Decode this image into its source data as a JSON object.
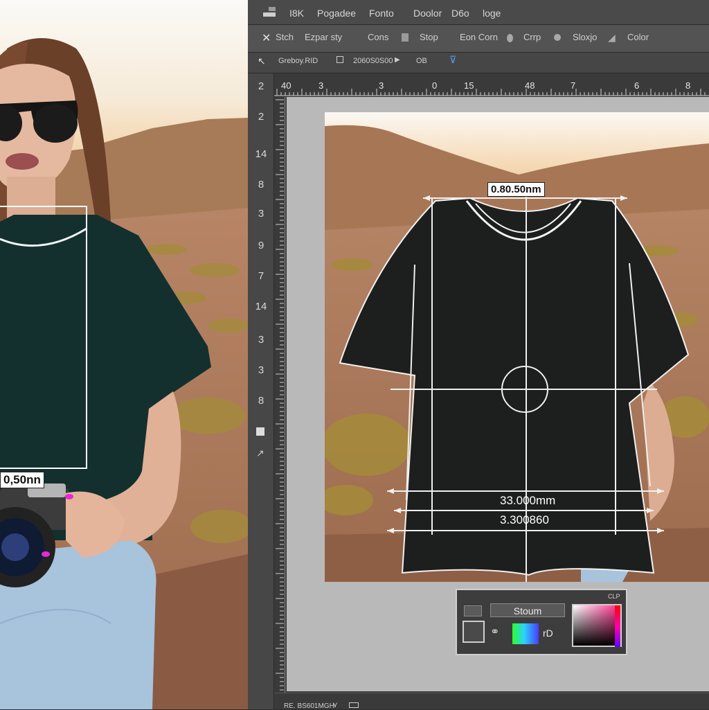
{
  "menu_bar": {
    "items": [
      "I8K",
      "Pogadee",
      "Fonto",
      "Doolor",
      "D6o",
      "loge"
    ]
  },
  "options_bar": {
    "items": [
      "Stch",
      "Ezpar sty",
      "Cons",
      "Stop",
      "Eon Corn",
      "Crrp",
      "Sloxjo",
      "Color"
    ]
  },
  "doc_tab_bar": {
    "doc_name": "Greboy.RID",
    "zoom_value": "2060S0S00",
    "mode": "OB"
  },
  "ruler": {
    "labels": [
      "40",
      "3",
      "3",
      "0",
      "15",
      "48",
      "7",
      "6",
      "8"
    ]
  },
  "toolbar": {
    "items": [
      "2",
      "2",
      "14",
      "8",
      "3",
      "9",
      "7",
      "14",
      "3",
      "3",
      "8"
    ]
  },
  "photo": {
    "measure_label": "0,50nn"
  },
  "canvas": {
    "top_measure": "0.80.50nm",
    "bottom_measure_1": "33.000mm",
    "bottom_measure_2": "3.300860"
  },
  "color_panel": {
    "header": "CLP",
    "field_value": "Stoum",
    "mode_label": "rD"
  },
  "status_bar": {
    "text": "RE. BS601MGH"
  },
  "colors": {
    "shirt": "#1d1e1e",
    "shirt_photo": "#13302f",
    "ui_dark": "#3c3c3c",
    "canvas_bg": "#b9b9b9",
    "accent_blue": "#5aa0ff"
  }
}
